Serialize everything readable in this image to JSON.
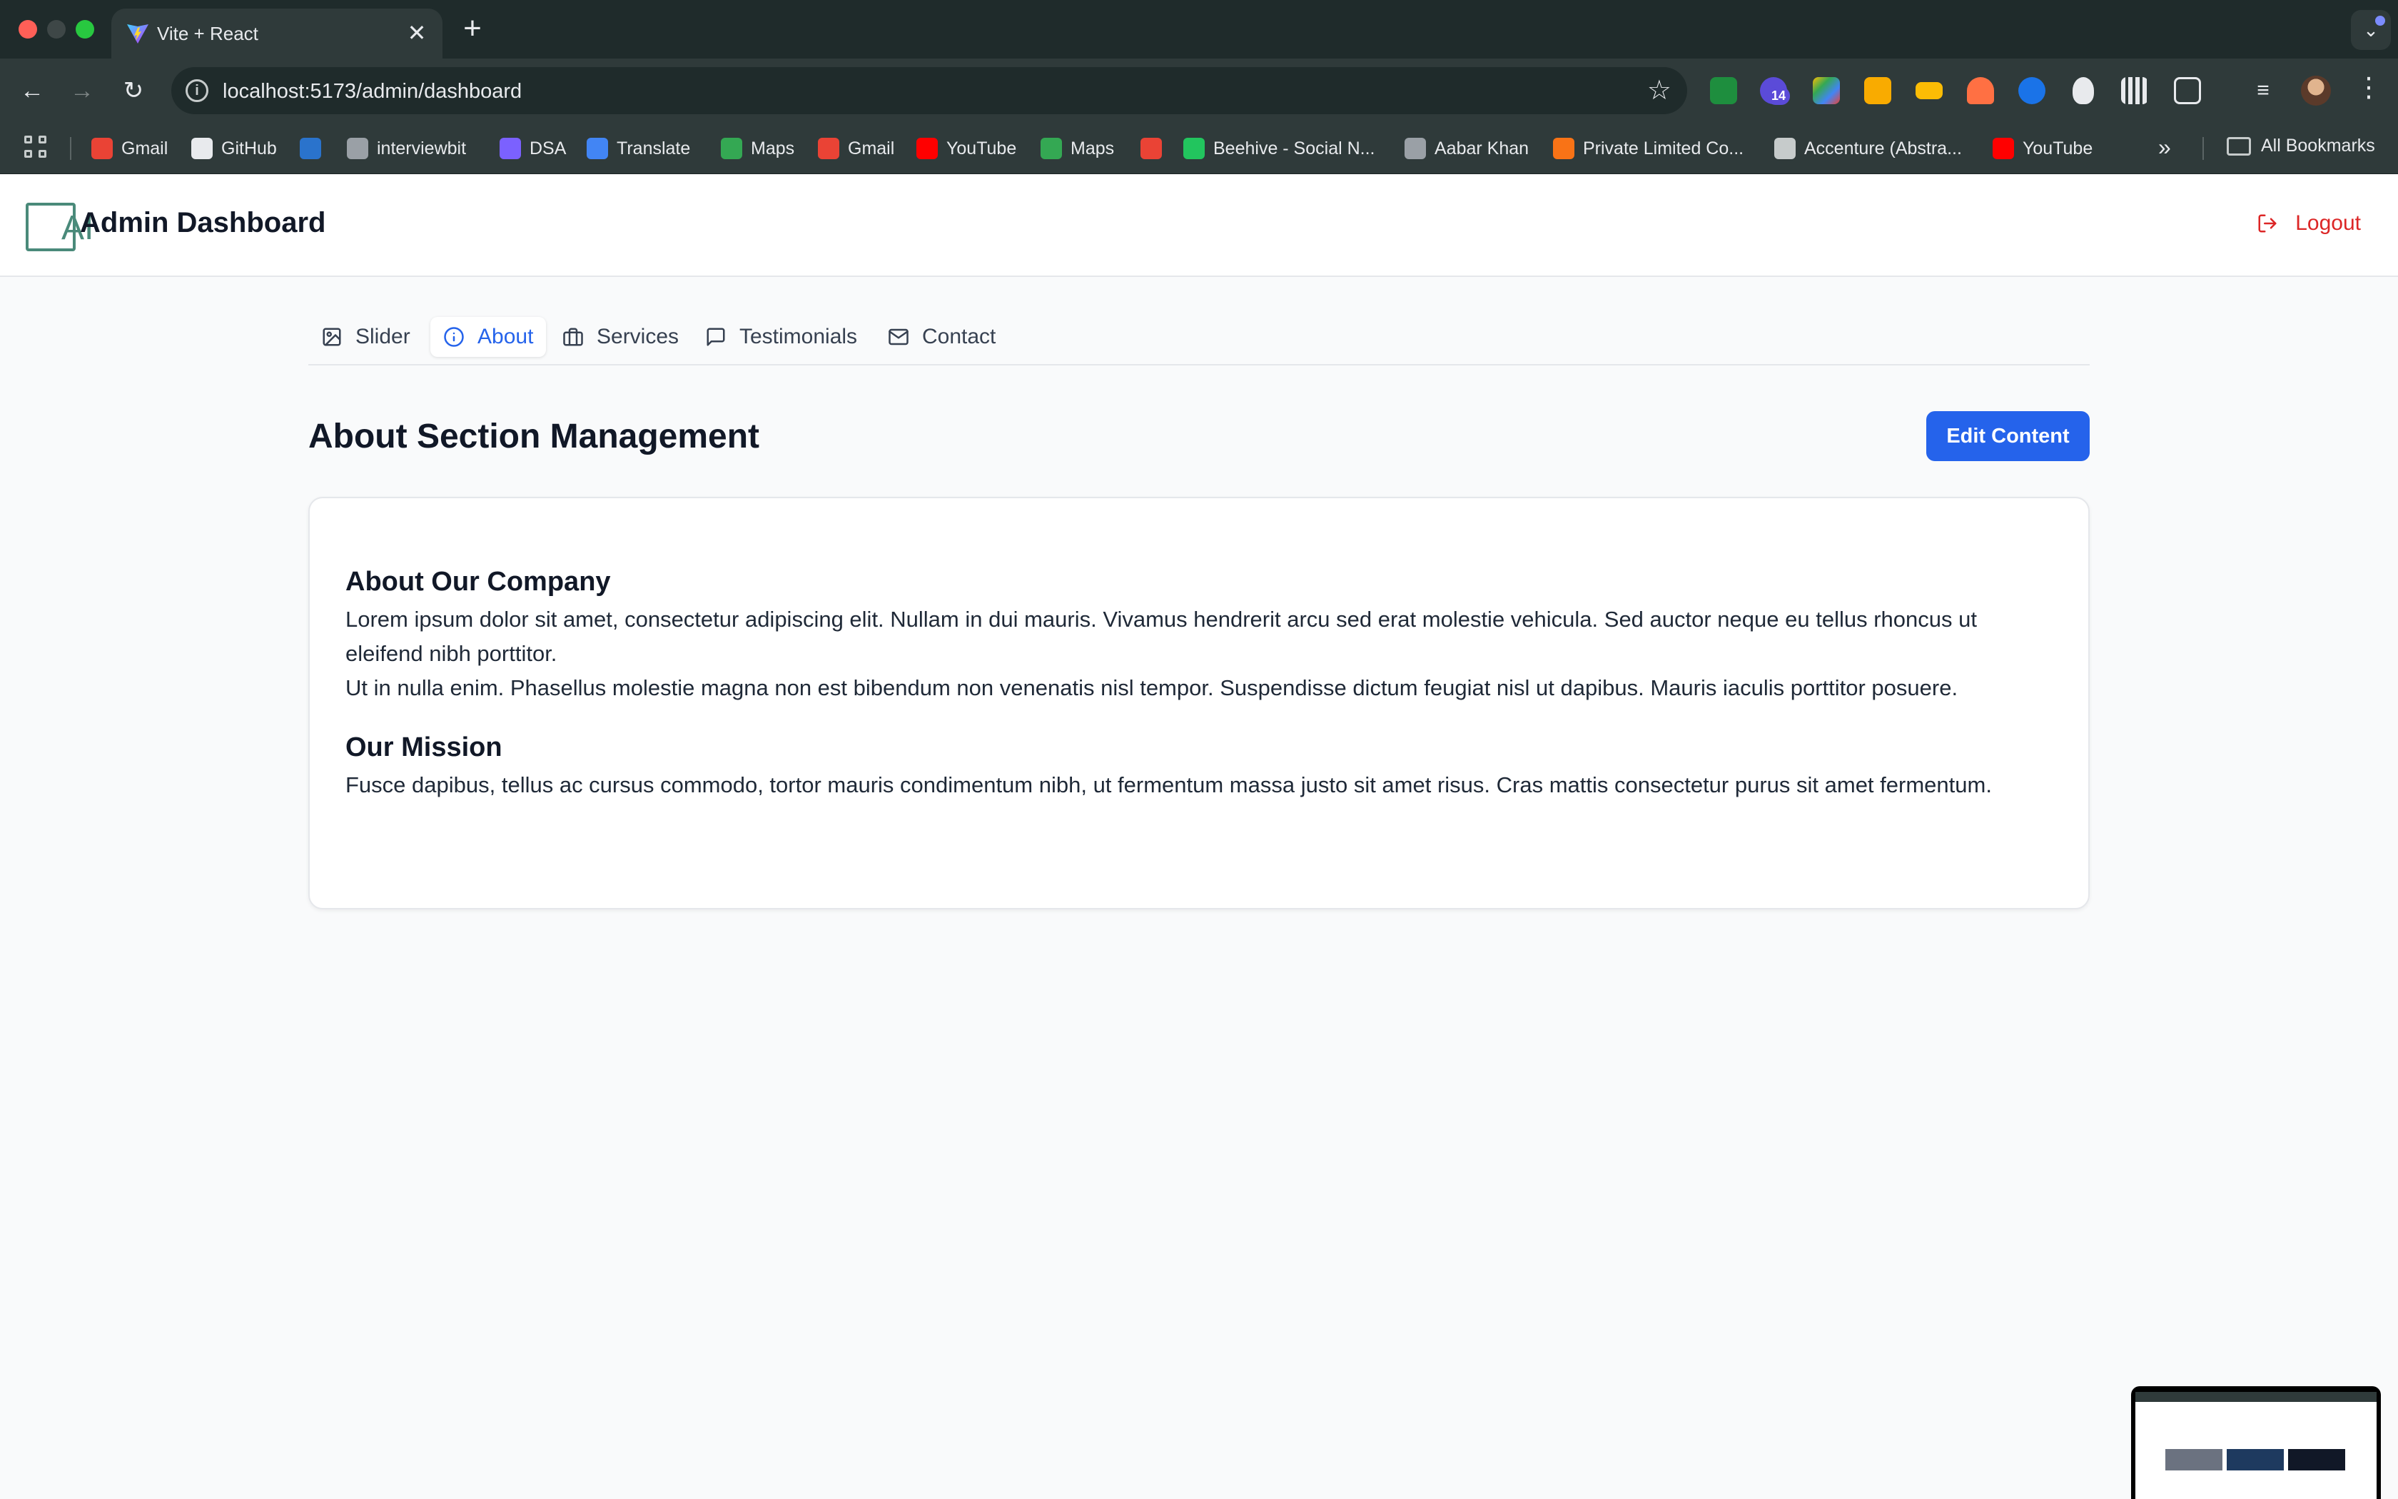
{
  "browser": {
    "tab_title": "Vite + React",
    "tab_close": "✕",
    "new_tab": "+",
    "url": "localhost:5173/admin/dashboard",
    "extension_badge": "14",
    "bookmarks": [
      {
        "label": "Gmail",
        "icon": "gmail-icon",
        "color": "#ea4335"
      },
      {
        "label": "GitHub",
        "icon": "github-icon",
        "color": "#e8eaed"
      },
      {
        "label": "",
        "icon": "coursera-icon",
        "color": "#2a73cc"
      },
      {
        "label": "interviewbit",
        "icon": "interviewbit-icon",
        "color": "#9aa0a6"
      },
      {
        "label": "DSA",
        "icon": "dsa-icon",
        "color": "#7b61ff"
      },
      {
        "label": "Translate",
        "icon": "translate-icon",
        "color": "#4285f4"
      },
      {
        "label": "Maps",
        "icon": "maps-icon",
        "color": "#34a853"
      },
      {
        "label": "Gmail",
        "icon": "gmail-icon",
        "color": "#ea4335"
      },
      {
        "label": "YouTube",
        "icon": "youtube-icon",
        "color": "#ff0000"
      },
      {
        "label": "Maps",
        "icon": "maps-icon",
        "color": "#34a853"
      },
      {
        "label": "",
        "icon": "gmail-icon",
        "color": "#ea4335"
      },
      {
        "label": "Beehive - Social N...",
        "icon": "beehive-icon",
        "color": "#22c55e"
      },
      {
        "label": "Aabar Khan",
        "icon": "profile-icon",
        "color": "#9aa0a6"
      },
      {
        "label": "Private Limited Co...",
        "icon": "company-icon",
        "color": "#f97316"
      },
      {
        "label": "Accenture (Abstra...",
        "icon": "globe-icon",
        "color": "#c6cbcb"
      },
      {
        "label": "YouTube",
        "icon": "youtube-icon",
        "color": "#ff0000"
      }
    ],
    "more_bookmarks": "»",
    "all_bookmarks": "All Bookmarks"
  },
  "header": {
    "logo_text": "AI",
    "title": "Admin Dashboard",
    "logout_label": "Logout"
  },
  "tabs": [
    {
      "label": "Slider",
      "icon": "image-icon",
      "active": false
    },
    {
      "label": "About",
      "icon": "info-icon",
      "active": true
    },
    {
      "label": "Services",
      "icon": "briefcase-icon",
      "active": false
    },
    {
      "label": "Testimonials",
      "icon": "message-icon",
      "active": false
    },
    {
      "label": "Contact",
      "icon": "mail-icon",
      "active": false
    }
  ],
  "section": {
    "title": "About Section Management",
    "edit_label": "Edit Content"
  },
  "content": {
    "company_heading": "About Our Company",
    "company_p1": "Lorem ipsum dolor sit amet, consectetur adipiscing elit. Nullam in dui mauris. Vivamus hendrerit arcu sed erat molestie vehicula. Sed auctor neque eu tellus rhoncus ut eleifend nibh porttitor.",
    "company_p2": "Ut in nulla enim. Phasellus molestie magna non est bibendum non venenatis nisl tempor. Suspendisse dictum feugiat nisl ut dapibus. Mauris iaculis porttitor posuere.",
    "mission_heading": "Our Mission",
    "mission_p": "Fusce dapibus, tellus ac cursus commodo, tortor mauris condimentum nibh, ut fermentum massa justo sit amet risus. Cras mattis consectetur purus sit amet fermentum."
  },
  "colors": {
    "accent": "#2563eb",
    "logout": "#dc2626",
    "chrome": "#2f3a3a"
  }
}
